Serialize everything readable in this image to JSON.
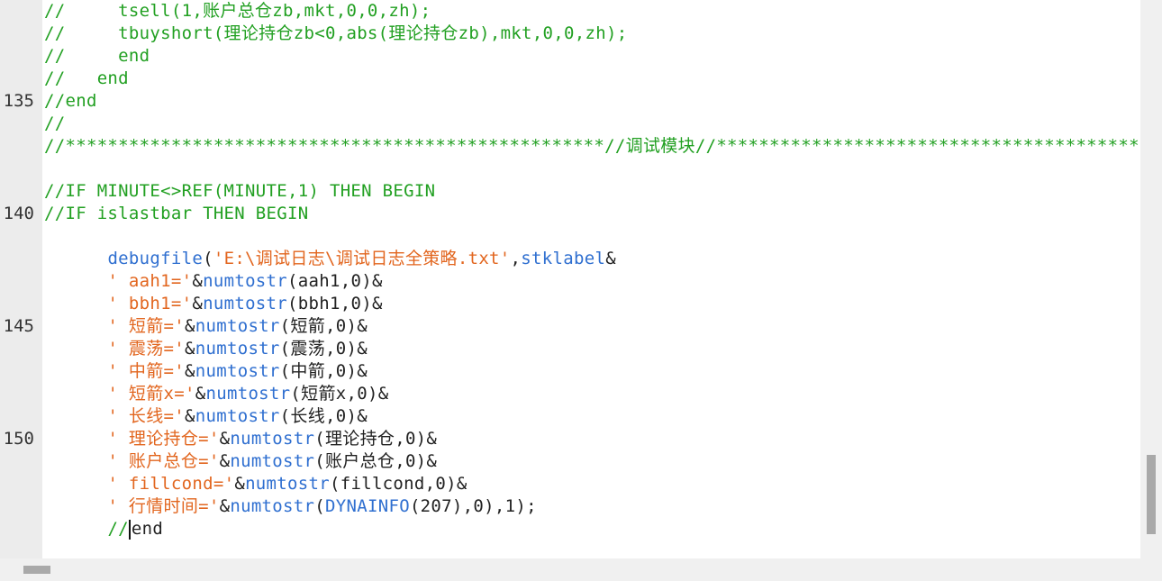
{
  "gutter": {
    "line_numbers": [
      "135",
      "140",
      "145",
      "150"
    ]
  },
  "code": {
    "l1": "//     tsell(1,账户总仓zb,mkt,0,0,zh);",
    "l2": "//     tbuyshort(理论持仓zb<0,abs(理论持仓zb),mkt,0,0,zh);",
    "l3": "//     end",
    "l4": "//   end",
    "l5": "//end",
    "l6": "//",
    "l7": "//***************************************************//调试模块//********************************************",
    "l8": "",
    "l9": "//IF MINUTE<>REF(MINUTE,1) THEN BEGIN",
    "l10": "//IF islastbar THEN BEGIN",
    "l11": {
      "fn": "debugfile",
      "p1": "(",
      "str": "'E:\\调试日志\\调试日志全策略.txt'",
      "p2": ",",
      "fn2": "stklabel",
      "p3": "&"
    },
    "l12": {
      "str": "' aah1='",
      "p1": "&",
      "fn": "numtostr",
      "p2": "(aah1,0)&"
    },
    "l13": {
      "str": "' bbh1='",
      "p1": "&",
      "fn": "numtostr",
      "p2": "(bbh1,0)&"
    },
    "l14": {
      "str": "' 短箭='",
      "p1": "&",
      "fn": "numtostr",
      "p2": "(短箭,0)&"
    },
    "l15": {
      "str": "' 震荡='",
      "p1": "&",
      "fn": "numtostr",
      "p2": "(震荡,0)&"
    },
    "l16": {
      "str": "' 中箭='",
      "p1": "&",
      "fn": "numtostr",
      "p2": "(中箭,0)&"
    },
    "l17": {
      "str": "' 短箭x='",
      "p1": "&",
      "fn": "numtostr",
      "p2": "(短箭x,0)&"
    },
    "l18": {
      "str": "' 长线='",
      "p1": "&",
      "fn": "numtostr",
      "p2": "(长线,0)&"
    },
    "l19": {
      "str": "' 理论持仓='",
      "p1": "&",
      "fn": "numtostr",
      "p2": "(理论持仓,0)&"
    },
    "l20": {
      "str": "' 账户总仓='",
      "p1": "&",
      "fn": "numtostr",
      "p2": "(账户总仓,0)&"
    },
    "l21": {
      "str": "' fillcond='",
      "p1": "&",
      "fn": "numtostr",
      "p2": "(fillcond,0)&"
    },
    "l22": {
      "str": "' 行情时间='",
      "p1": "&",
      "fn": "numtostr",
      "p2": "(",
      "fn2": "DYNAINFO",
      "p3": "(207),0),1);"
    },
    "l23": {
      "cmt": "//",
      "plain": "end"
    }
  },
  "colors": {
    "comment": "#22a022",
    "string": "#e2661f",
    "function": "#2f6fd0",
    "plain": "#222222"
  }
}
